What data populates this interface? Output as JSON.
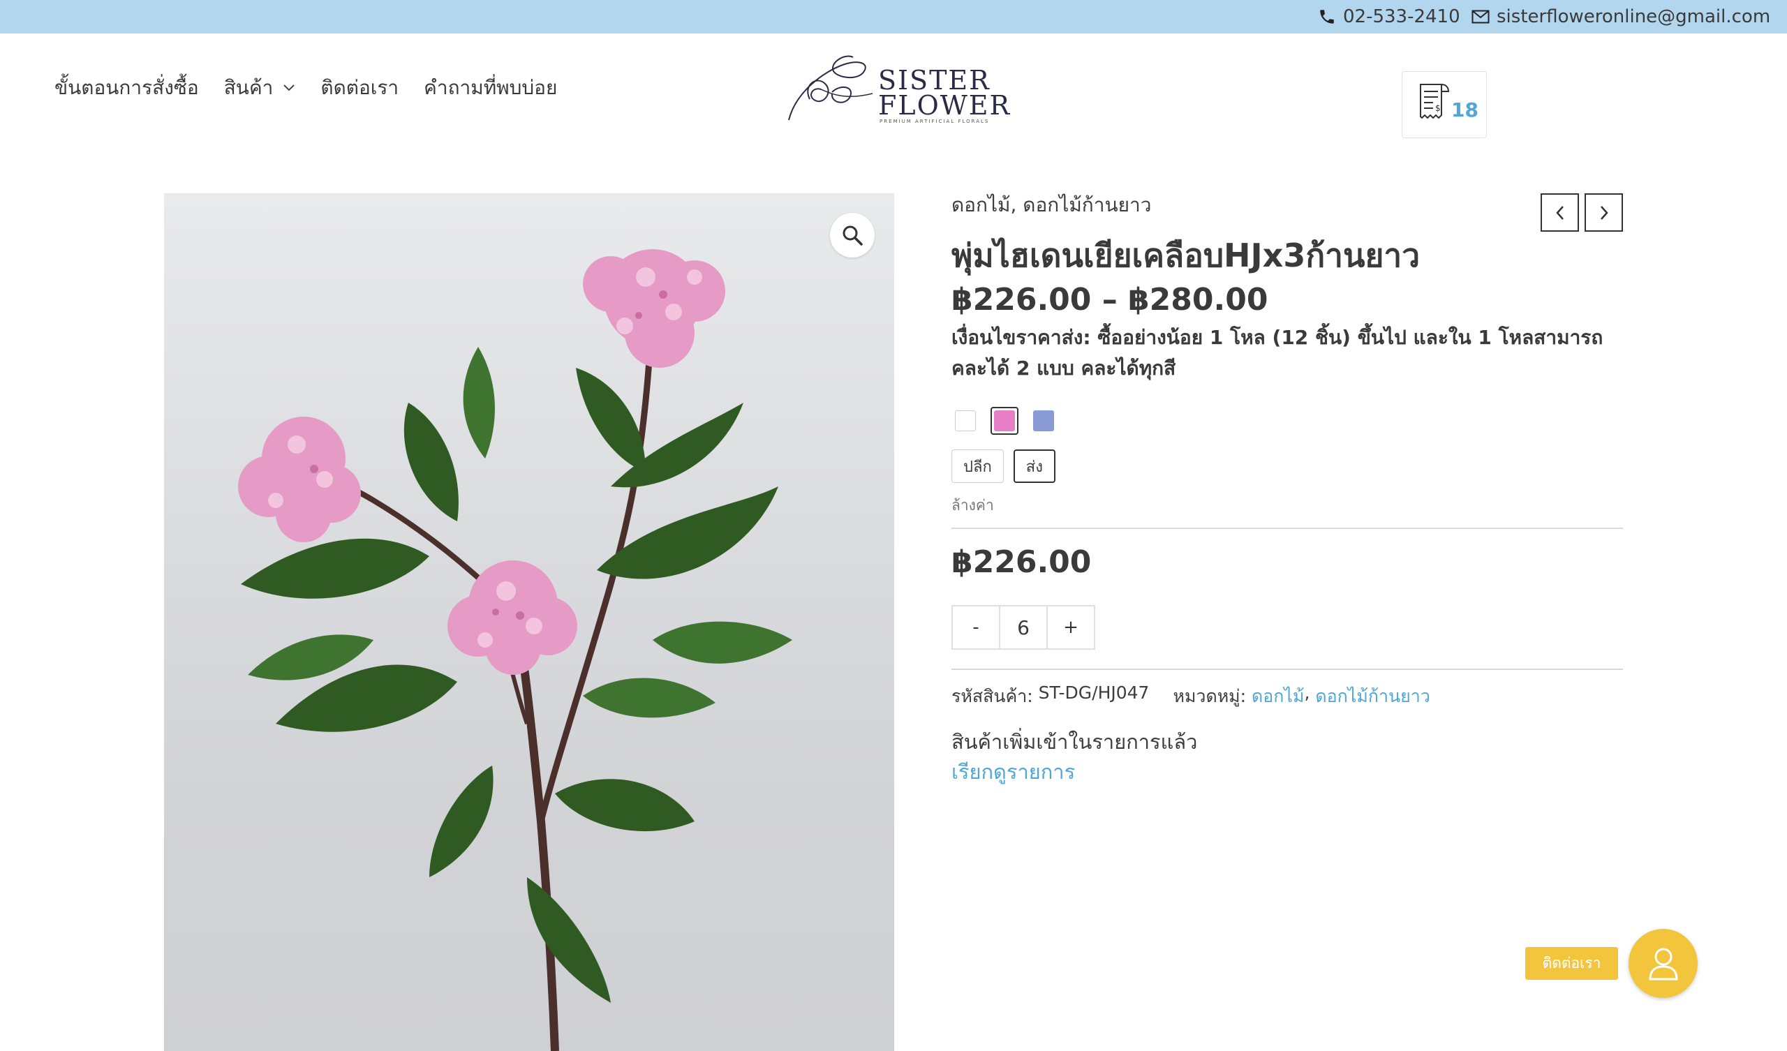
{
  "topbar": {
    "phone": "02-533-2410",
    "email": "sisterfloweronline@gmail.com",
    "background": "#b3d6ef"
  },
  "nav": {
    "items": [
      {
        "label": "ขั้นตอนการสั่งซื้อ"
      },
      {
        "label": "สินค้า",
        "has_dropdown": true
      },
      {
        "label": "ติดต่อเรา"
      },
      {
        "label": "คำถามที่พบบ่อย"
      }
    ]
  },
  "logo": {
    "line1": "SISTER",
    "line2": "FLOWER",
    "tagline": "PREMIUM ARTIFICIAL FLORALS"
  },
  "cart": {
    "count": "18",
    "icon": "receipt-icon"
  },
  "product": {
    "categories_line": "ดอกไม้, ดอกไม้ก้านยาว",
    "title": "พุ่มไฮเดนเยียเคลือบHJx3ก้านยาว",
    "price_range": "฿226.00 – ฿280.00",
    "condition": "เงื่อนไขราคาส่ง: ซื้ออย่างน้อย 1 โหล (12 ชิ้น) ขึ้นไป และใน 1 โหลสามารถคละได้ 2 แบบ คละได้ทุกสี",
    "swatches": [
      {
        "color": "#ffffff",
        "selected": false
      },
      {
        "color": "#e77fc8",
        "selected": true
      },
      {
        "color": "#8a9bd6",
        "selected": false
      }
    ],
    "options": [
      {
        "label": "ปลีก",
        "selected": false
      },
      {
        "label": "ส่ง",
        "selected": true
      }
    ],
    "clear_label": "ล้างค่า",
    "price": "฿226.00",
    "quantity": {
      "minus": "-",
      "value": "6",
      "plus": "+"
    },
    "sku_label": "รหัสสินค้า:",
    "sku": "ST-DG/HJ047",
    "category_label": "หมวดหมู่:",
    "category_links": [
      "ดอกไม้",
      "ดอกไม้ก้านยาว"
    ],
    "category_separator": ",",
    "added_message": "สินค้าเพิ่มเข้าในรายการแล้ว",
    "view_link": "เรียกดูรายการ"
  },
  "floating_contact": {
    "label": "ติดต่อเรา",
    "accent": "#f2c53d",
    "icon": "user-icon"
  },
  "colors": {
    "link": "#4ea7d8",
    "text": "#3a3a3a"
  }
}
